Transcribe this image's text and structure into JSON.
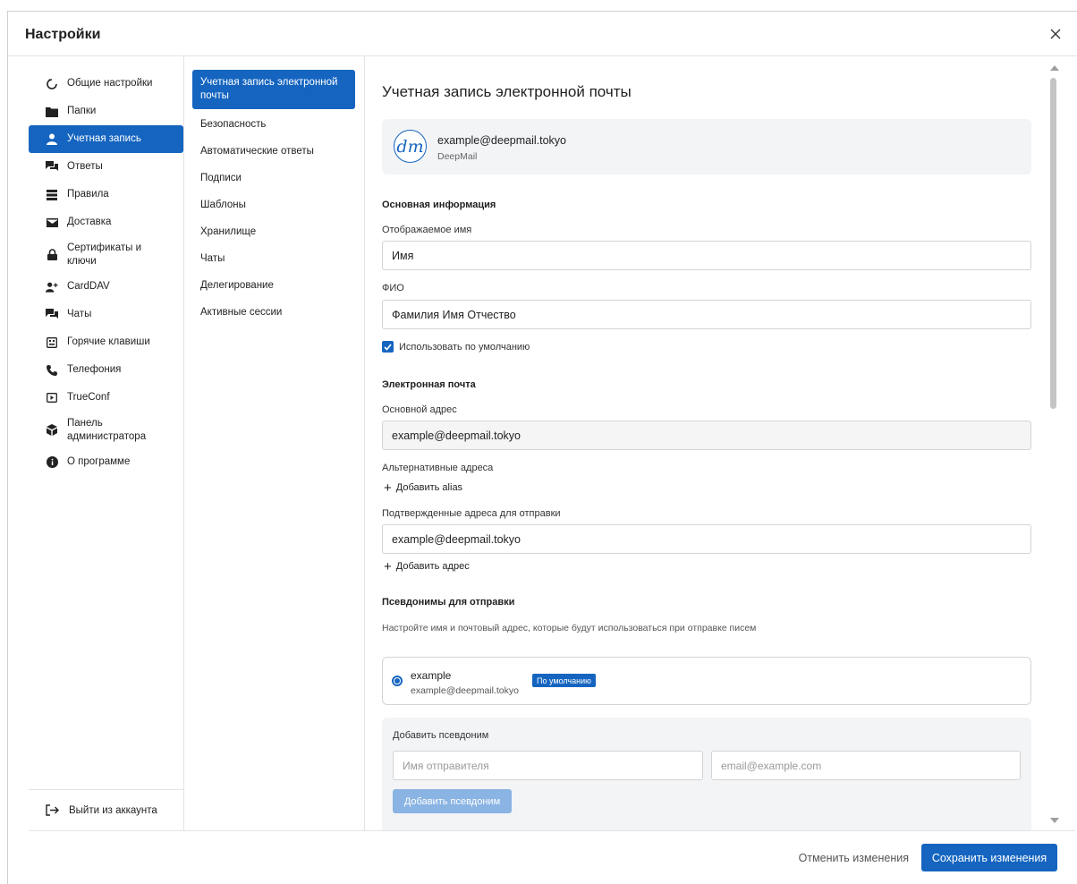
{
  "dialog": {
    "title": "Настройки",
    "close_icon": "close-icon"
  },
  "sidebar": {
    "items": [
      {
        "label": "Общие настройки",
        "icon": "general-settings-icon",
        "active": false
      },
      {
        "label": "Папки",
        "icon": "folder-icon",
        "active": false
      },
      {
        "label": "Учетная запись",
        "icon": "user-icon",
        "active": true
      },
      {
        "label": "Ответы",
        "icon": "replies-icon",
        "active": false
      },
      {
        "label": "Правила",
        "icon": "rules-icon",
        "active": false
      },
      {
        "label": "Доставка",
        "icon": "envelope-icon",
        "active": false
      },
      {
        "label": "Сертификаты и ключи",
        "icon": "lock-icon",
        "active": false
      },
      {
        "label": "CardDAV",
        "icon": "add-user-icon",
        "active": false
      },
      {
        "label": "Чаты",
        "icon": "chat-icon",
        "active": false
      },
      {
        "label": "Горячие клавиши",
        "icon": "keyboard-icon",
        "active": false
      },
      {
        "label": "Телефония",
        "icon": "phone-icon",
        "active": false
      },
      {
        "label": "TrueConf",
        "icon": "video-icon",
        "active": false
      },
      {
        "label": "Панель администратора",
        "icon": "admin-icon",
        "active": false
      },
      {
        "label": "О программе",
        "icon": "info-icon",
        "active": false
      }
    ],
    "logout_label": "Выйти из аккаунта"
  },
  "subnav": {
    "items": [
      {
        "label": "Учетная запись электронной почты",
        "active": true
      },
      {
        "label": "Безопасность",
        "active": false
      },
      {
        "label": "Автоматические ответы",
        "active": false
      },
      {
        "label": "Подписи",
        "active": false
      },
      {
        "label": "Шаблоны",
        "active": false
      },
      {
        "label": "Хранилище",
        "active": false
      },
      {
        "label": "Чаты",
        "active": false
      },
      {
        "label": "Делегирование",
        "active": false
      },
      {
        "label": "Активные сессии",
        "active": false
      }
    ]
  },
  "main": {
    "title": "Учетная запись электронной почты",
    "account": {
      "avatar_text": "dm",
      "email": "example@deepmail.tokyo",
      "provider": "DeepMail"
    },
    "basic_info": {
      "section_title": "Основная информация",
      "display_name_label": "Отображаемое имя",
      "display_name_value": "Имя",
      "fio_label": "ФИО",
      "fio_value": "Фамилия Имя Отчество",
      "use_default_label": "Использовать по умолчанию",
      "use_default_checked": true
    },
    "email": {
      "section_title": "Электронная почта",
      "primary_label": "Основной адрес",
      "primary_value": "example@deepmail.tokyo",
      "alternate_label": "Альтернативные адреса",
      "add_alias_link": "Добавить alias",
      "confirmed_label": "Подтвержденные адреса для отправки",
      "confirmed_value": "example@deepmail.tokyo",
      "add_address_link": "Добавить адрес"
    },
    "pseudonyms": {
      "section_title": "Псевдонимы для отправки",
      "hint": "Настройте имя и почтовый адрес, которые будут использоваться при отправке писем",
      "items": [
        {
          "name": "example",
          "email": "example@deepmail.tokyo",
          "badge": "По умолчанию",
          "selected": true
        }
      ],
      "add_box": {
        "title": "Добавить псевдоним",
        "sender_placeholder": "Имя отправителя",
        "email_placeholder": "email@example.com",
        "button_label": "Добавить псевдоним"
      }
    }
  },
  "footer": {
    "cancel_label": "Отменить изменения",
    "save_label": "Сохранить изменения"
  },
  "colors": {
    "accent": "#1565c0",
    "accent_disabled": "#8ab4e3",
    "card_bg": "#f3f4f6",
    "border": "#d4d4d4"
  }
}
